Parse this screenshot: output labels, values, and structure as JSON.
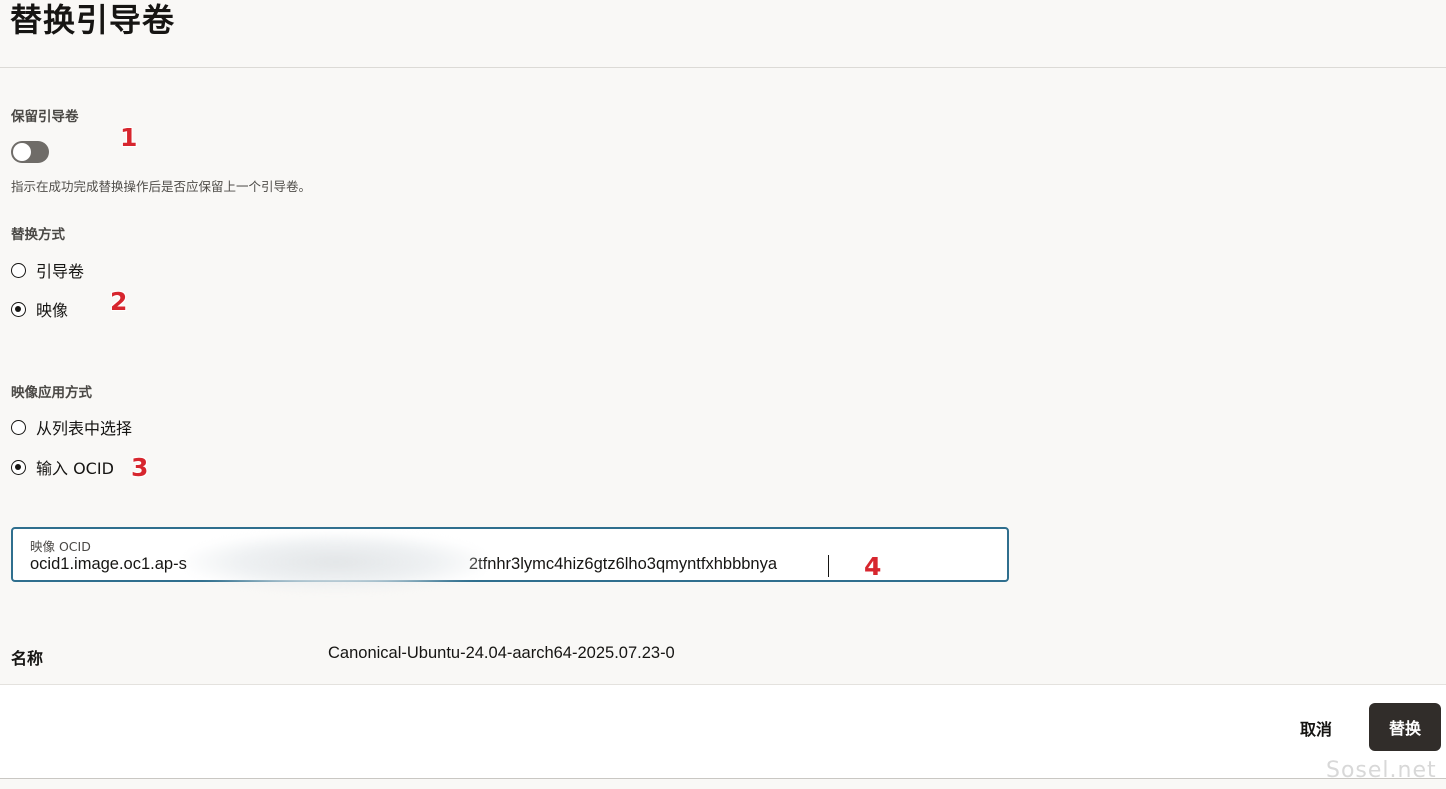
{
  "page": {
    "title": "替换引导卷"
  },
  "preserve_boot_volume": {
    "label": "保留引导卷",
    "enabled": false,
    "help_text": "指示在成功完成替换操作后是否应保留上一个引导卷。"
  },
  "replace_method": {
    "label": "替换方式",
    "options": [
      {
        "label": "引导卷",
        "selected": false
      },
      {
        "label": "映像",
        "selected": true
      }
    ]
  },
  "image_apply_method": {
    "label": "映像应用方式",
    "options": [
      {
        "label": "从列表中选择",
        "selected": false
      },
      {
        "label": "输入 OCID",
        "selected": true
      }
    ]
  },
  "image_ocid_field": {
    "label": "映像 OCID",
    "value_visible_prefix": "ocid1.image.oc1.ap-s",
    "value_visible_suffix": "2tfnhr3lymc4hiz6gtz6lho3qmyntfxhbbbnya"
  },
  "image_name": {
    "label": "名称",
    "value": "Canonical-Ubuntu-24.04-aarch64-2025.07.23-0"
  },
  "annotations": [
    "1",
    "2",
    "3",
    "4"
  ],
  "footer": {
    "cancel_label": "取消",
    "submit_label": "替换"
  },
  "watermark": "Sosel.net",
  "colors": {
    "primary_button": "#312d2a",
    "field_border": "#2f6f8e",
    "annotation": "#d7262e"
  }
}
